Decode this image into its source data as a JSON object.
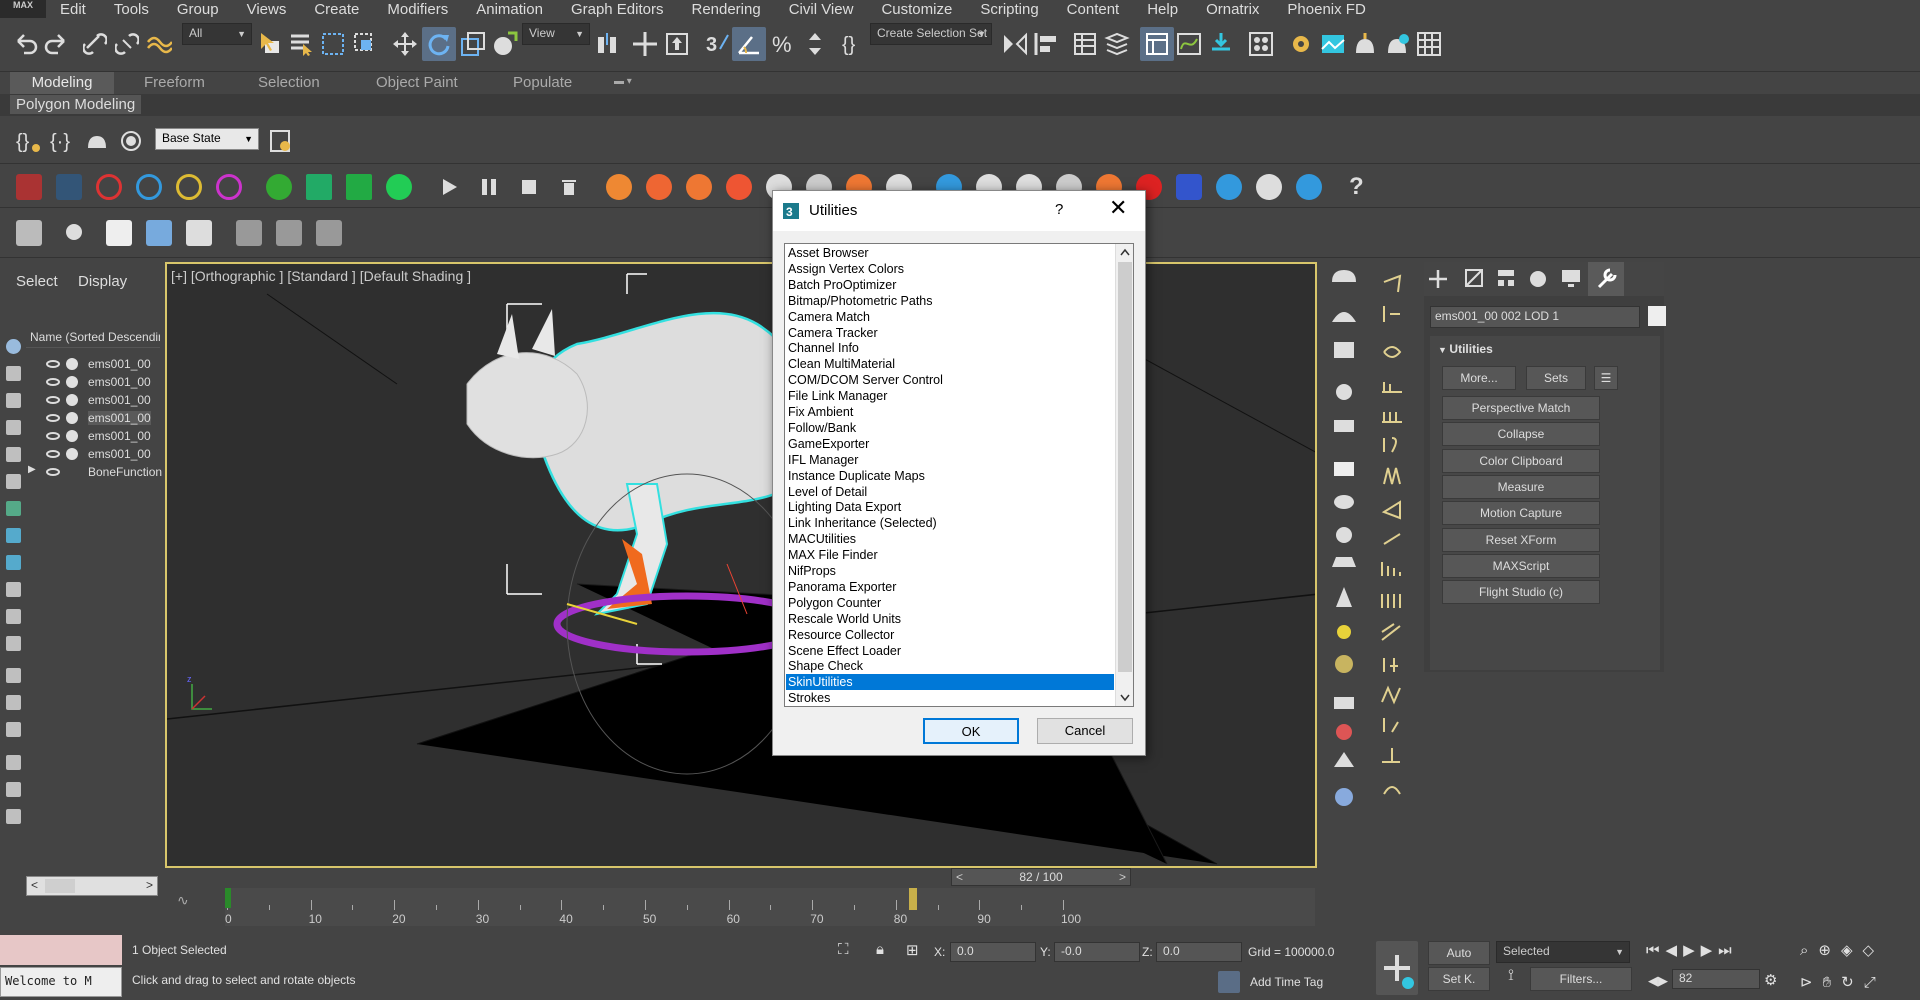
{
  "app": {
    "logo": "MAX"
  },
  "menu": [
    "Edit",
    "Tools",
    "Group",
    "Views",
    "Create",
    "Modifiers",
    "Animation",
    "Graph Editors",
    "Rendering",
    "Civil View",
    "Customize",
    "Scripting",
    "Content",
    "Help",
    "Ornatrix",
    "Phoenix FD"
  ],
  "toolbar": {
    "filter_value": "All",
    "refcoord_value": "View",
    "selection_set": "Create Selection Set"
  },
  "ribbon": {
    "tabs": [
      "Modeling",
      "Freeform",
      "Selection",
      "Object Paint",
      "Populate"
    ],
    "panel_label": "Polygon Modeling",
    "state_value": "Base State"
  },
  "scene_explorer": {
    "tabs": [
      "Select",
      "Display"
    ],
    "header": "Name (Sorted Descending)",
    "rows": [
      {
        "name": "ems001_00"
      },
      {
        "name": "ems001_00"
      },
      {
        "name": "ems001_00"
      },
      {
        "name": "ems001_00"
      },
      {
        "name": "ems001_00"
      },
      {
        "name": "ems001_00"
      },
      {
        "name": "BoneFunction"
      }
    ]
  },
  "viewport": {
    "label": "[+] [Orthographic ] [Standard ] [Default Shading ]"
  },
  "command_panel": {
    "object_name": "ems001_00 002 LOD 1",
    "rollout_title": "Utilities",
    "more_label": "More...",
    "sets_label": "Sets",
    "buttons": [
      "Perspective Match",
      "Collapse",
      "Color Clipboard",
      "Measure",
      "Motion Capture",
      "Reset XForm",
      "MAXScript",
      "Flight Studio (c)"
    ]
  },
  "timeline": {
    "counter": "82 / 100",
    "current": 82,
    "total": 100,
    "ticks": [
      "0",
      "10",
      "20",
      "30",
      "40",
      "50",
      "60",
      "70",
      "80",
      "90",
      "100"
    ]
  },
  "status": {
    "maxscript_prompt": "Welcome to M",
    "objects_selected": "1 Object Selected",
    "hint": "Click and drag to select and rotate objects",
    "x_label": "X:",
    "x_value": "0.0",
    "y_label": "Y:",
    "y_value": "-0.0",
    "z_label": "Z:",
    "z_value": "0.0",
    "grid": "Grid = 100000.0",
    "add_time_tag": "Add Time Tag",
    "auto_label": "Auto",
    "setk_label": "Set K.",
    "key_mode": "Selected",
    "filters_label": "Filters...",
    "frame_value": "82"
  },
  "dialog": {
    "title": "Utilities",
    "help": "?",
    "close": "✕",
    "items": [
      "Asset Browser",
      "Assign Vertex Colors",
      "Batch ProOptimizer",
      "Bitmap/Photometric Paths",
      "Camera Match",
      "Camera Tracker",
      "Channel Info",
      "Clean MultiMaterial",
      "COM/DCOM Server Control",
      "File Link Manager",
      "Fix Ambient",
      "Follow/Bank",
      "GameExporter",
      "IFL Manager",
      "Instance Duplicate Maps",
      "Level of Detail",
      "Lighting Data Export",
      "Link Inheritance (Selected)",
      "MACUtilities",
      "MAX File Finder",
      "NifProps",
      "Panorama Exporter",
      "Polygon Counter",
      "Rescale World Units",
      "Resource Collector",
      "Scene Effect Loader",
      "Shape Check",
      "SkinUtilities",
      "Strokes"
    ],
    "selected_index": 27,
    "ok_label": "OK",
    "cancel_label": "Cancel"
  },
  "colors": {
    "accent": "#0078d7",
    "viewport_border": "#d8c66b",
    "selection_cyan": "#33e0e0"
  }
}
